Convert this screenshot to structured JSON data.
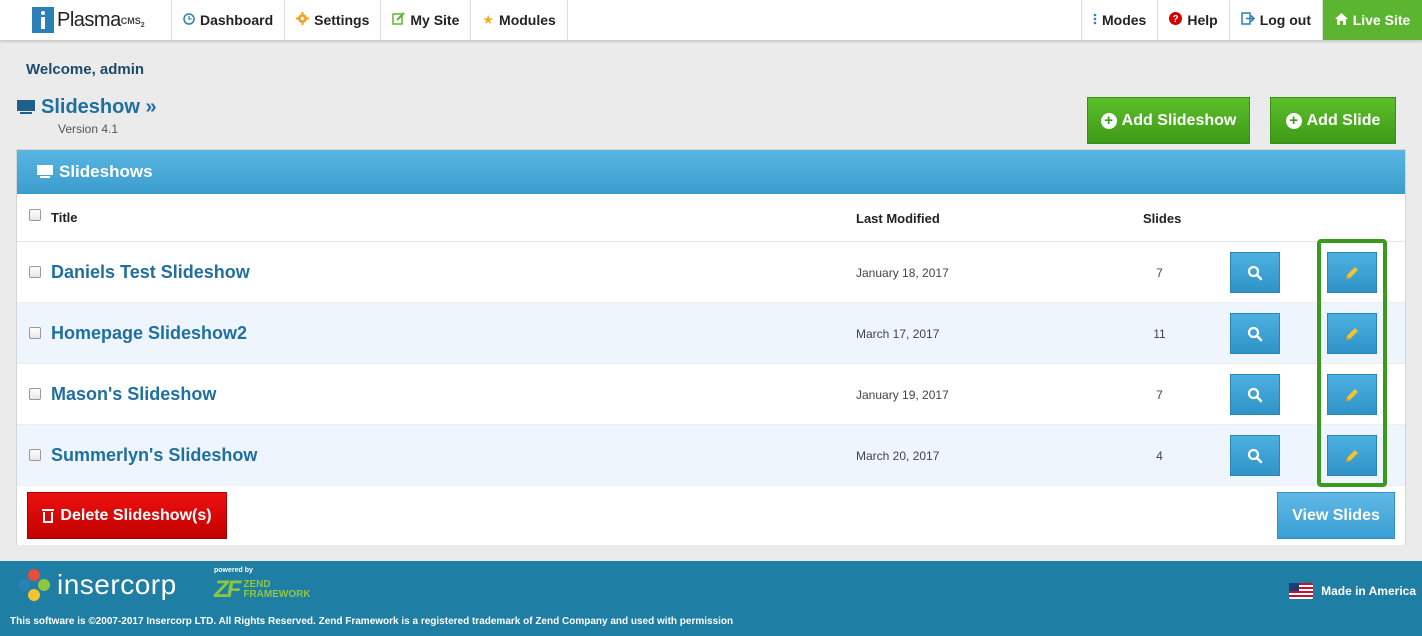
{
  "nav": {
    "logo_text": "Plasma",
    "logo_sup": "CMS",
    "logo_sub": "2",
    "left_items": [
      {
        "label": "Dashboard",
        "icon": "clock-icon"
      },
      {
        "label": "Settings",
        "icon": "gear-icon"
      },
      {
        "label": "My Site",
        "icon": "edit-icon"
      },
      {
        "label": "Modules",
        "icon": "star-icon"
      }
    ],
    "right_items": [
      {
        "label": "Modes",
        "icon": "vertical-dots-icon"
      },
      {
        "label": "Help",
        "icon": "help-icon"
      },
      {
        "label": "Log out",
        "icon": "logout-icon"
      },
      {
        "label": "Live Site",
        "icon": "home-icon"
      }
    ]
  },
  "welcome": "Welcome, admin",
  "page": {
    "title": "Slideshow »",
    "version": "Version 4.1",
    "add_slideshow_label": "Add Slideshow",
    "add_slide_label": "Add Slide"
  },
  "panel": {
    "title": "Slideshows",
    "columns": {
      "title": "Title",
      "last_modified": "Last Modified",
      "slides": "Slides"
    },
    "rows": [
      {
        "title": "Daniels Test Slideshow",
        "modified": "January 18, 2017",
        "slides": "7"
      },
      {
        "title": "Homepage Slideshow2",
        "modified": "March 17, 2017",
        "slides": "11"
      },
      {
        "title": "Mason's Slideshow",
        "modified": "January 19, 2017",
        "slides": "7"
      },
      {
        "title": "Summerlyn's Slideshow",
        "modified": "March 20, 2017",
        "slides": "4"
      }
    ],
    "delete_label": "Delete Slideshow(s)",
    "view_label": "View Slides"
  },
  "footer": {
    "brand": "insercorp",
    "powered_by": "powered by",
    "zend_line1": "ZEND",
    "zend_line2": "FRAMEWORK",
    "copyright": "This software is ©2007-2017 Insercorp LTD. All Rights Reserved. Zend Framework is a registered trademark of Zend Company and used with permission",
    "made_in": "Made in America"
  },
  "colors": {
    "accent_blue": "#3a9ccd",
    "green": "#5cb531",
    "red": "#d40000",
    "footer": "#1f7ea3",
    "highlight": "#3a9a1e"
  }
}
